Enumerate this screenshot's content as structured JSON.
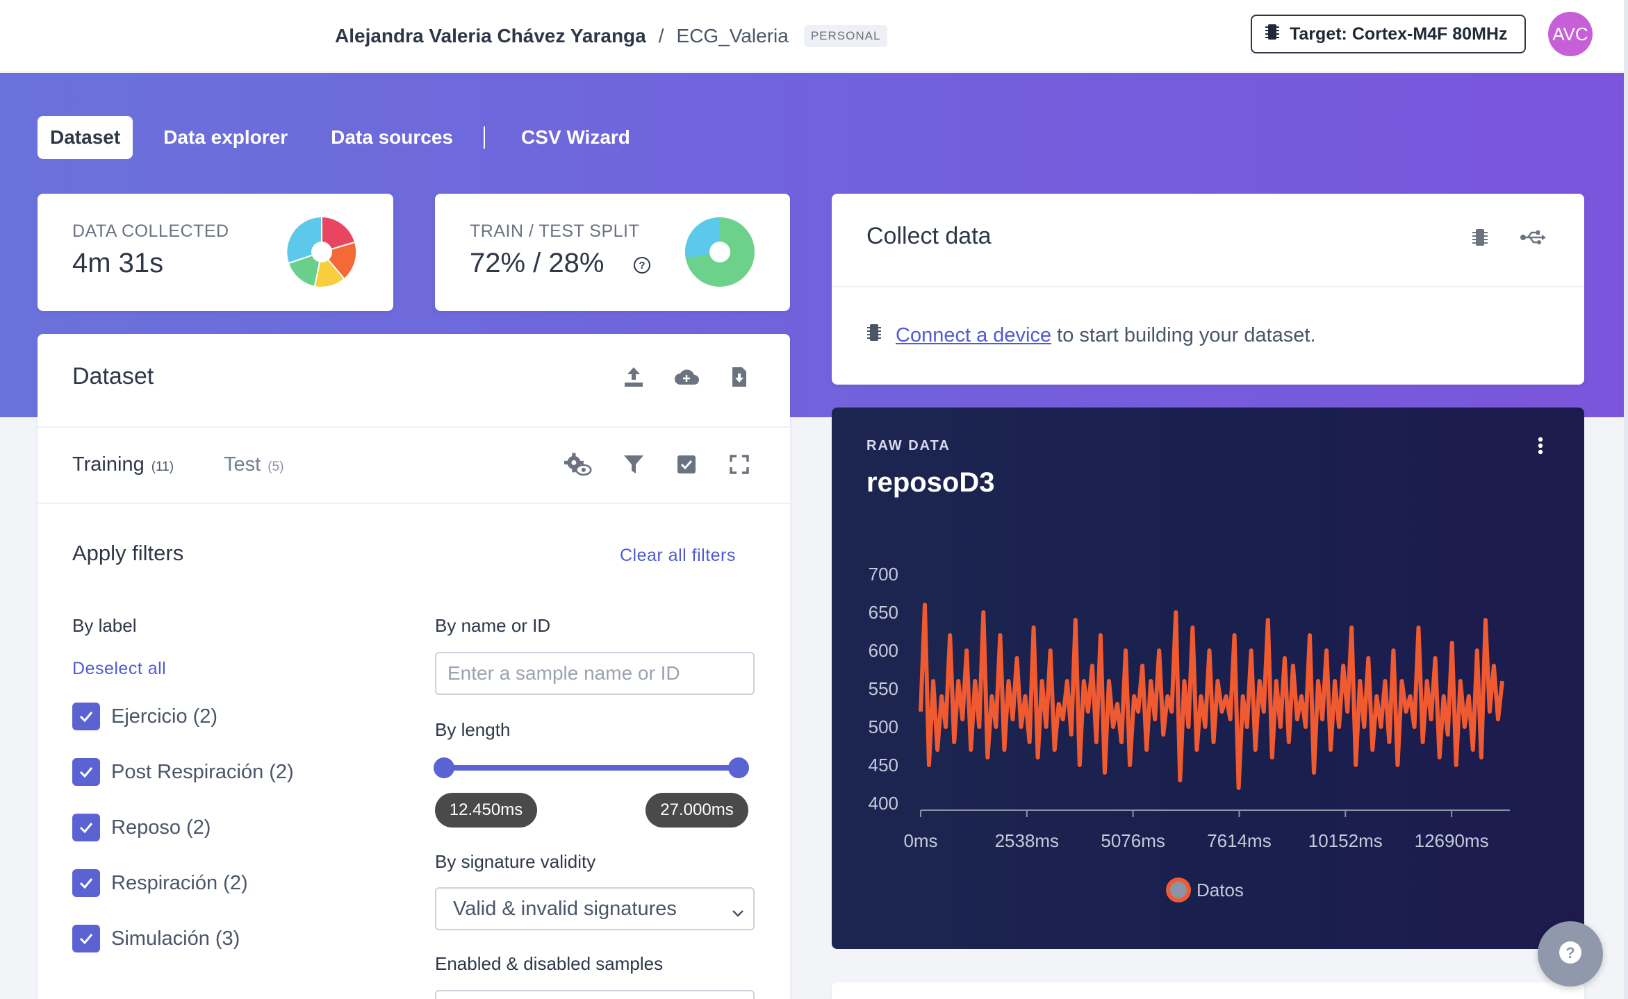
{
  "header": {
    "owner": "Alejandra Valeria Chávez Yaranga",
    "separator": "/",
    "project": "ECG_Valeria",
    "badge": "PERSONAL",
    "target_label": "Target: Cortex-M4F 80MHz",
    "avatar_initials": "AVC"
  },
  "tabs": [
    {
      "label": "Dataset",
      "active": true
    },
    {
      "label": "Data explorer",
      "active": false
    },
    {
      "label": "Data sources",
      "active": false
    },
    {
      "label": "CSV Wizard",
      "active": false
    }
  ],
  "stats": {
    "data_collected": {
      "label": "DATA COLLECTED",
      "value": "4m 31s"
    },
    "split": {
      "label": "TRAIN / TEST SPLIT",
      "value": "72% / 28%",
      "train_fraction": 0.72
    }
  },
  "collect": {
    "title": "Collect data",
    "link_text": "Connect a device",
    "rest_text": " to start building your dataset."
  },
  "dataset": {
    "title": "Dataset",
    "training_label": "Training",
    "training_count": "(11)",
    "test_label": "Test",
    "test_count": "(5)"
  },
  "filters": {
    "title": "Apply filters",
    "clear_all": "Clear all filters",
    "by_label": "By label",
    "deselect_all": "Deselect all",
    "labels": [
      {
        "text": "Ejercicio (2)",
        "checked": true
      },
      {
        "text": "Post Respiración (2)",
        "checked": true
      },
      {
        "text": "Reposo (2)",
        "checked": true
      },
      {
        "text": "Respiración (2)",
        "checked": true
      },
      {
        "text": "Simulación (3)",
        "checked": true
      }
    ],
    "by_name": "By name or ID",
    "name_placeholder": "Enter a sample name or ID",
    "by_length": "By length",
    "length_min": "12.450ms",
    "length_max": "27.000ms",
    "by_signature": "By signature validity",
    "signature_value": "Valid & invalid signatures",
    "enabled_label": "Enabled & disabled samples"
  },
  "raw": {
    "label": "RAW DATA",
    "title": "reposoD3"
  },
  "colors": {
    "accent": "#5b63d3",
    "series": "#f05a30",
    "chart_bg": "#1c2150"
  },
  "chart_data": {
    "type": "line",
    "legend_position": "bottom-center",
    "x_ticks": [
      "0ms",
      "2538ms",
      "5076ms",
      "7614ms",
      "10152ms",
      "12690ms"
    ],
    "ylim": [
      400,
      700
    ],
    "y_ticks": [
      "700",
      "650",
      "600",
      "550",
      "500",
      "450",
      "400"
    ],
    "xlim": [
      0,
      14000
    ],
    "series": [
      {
        "name": "Datos",
        "color": "#f05a30",
        "x": [
          0,
          100,
          200,
          300,
          400,
          500,
          600,
          700,
          800,
          900,
          1000,
          1100,
          1200,
          1300,
          1400,
          1500,
          1600,
          1700,
          1800,
          1900,
          2000,
          2100,
          2200,
          2300,
          2400,
          2500,
          2600,
          2700,
          2800,
          2900,
          3000,
          3100,
          3200,
          3300,
          3400,
          3500,
          3600,
          3700,
          3800,
          3900,
          4000,
          4100,
          4200,
          4300,
          4400,
          4500,
          4600,
          4700,
          4800,
          4900,
          5000,
          5100,
          5200,
          5300,
          5400,
          5500,
          5600,
          5700,
          5800,
          5900,
          6000,
          6100,
          6200,
          6300,
          6400,
          6500,
          6600,
          6700,
          6800,
          6900,
          7000,
          7100,
          7200,
          7300,
          7400,
          7500,
          7600,
          7700,
          7800,
          7900,
          8000,
          8100,
          8200,
          8300,
          8400,
          8500,
          8600,
          8700,
          8800,
          8900,
          9000,
          9100,
          9200,
          9300,
          9400,
          9500,
          9600,
          9700,
          9800,
          9900,
          10000,
          10100,
          10200,
          10300,
          10400,
          10500,
          10600,
          10700,
          10800,
          10900,
          11000,
          11100,
          11200,
          11300,
          11400,
          11500,
          11600,
          11700,
          11800,
          11900,
          12000,
          12100,
          12200,
          12300,
          12400,
          12500,
          12600,
          12700,
          12800,
          12900,
          13000,
          13100,
          13200,
          13300,
          13400,
          13500,
          13600,
          13700,
          13800,
          13900
        ],
        "values": [
          520,
          660,
          450,
          560,
          470,
          540,
          500,
          620,
          480,
          560,
          510,
          600,
          470,
          560,
          500,
          650,
          460,
          540,
          500,
          620,
          470,
          560,
          510,
          590,
          500,
          540,
          480,
          630,
          460,
          560,
          500,
          600,
          470,
          530,
          510,
          560,
          490,
          640,
          450,
          560,
          520,
          580,
          480,
          620,
          440,
          560,
          500,
          530,
          480,
          600,
          450,
          540,
          520,
          580,
          470,
          560,
          510,
          600,
          490,
          540,
          520,
          650,
          430,
          560,
          500,
          630,
          470,
          540,
          500,
          600,
          480,
          560,
          520,
          540,
          510,
          620,
          420,
          540,
          500,
          600,
          470,
          560,
          520,
          640,
          460,
          560,
          500,
          590,
          480,
          580,
          510,
          540,
          500,
          620,
          440,
          560,
          510,
          600,
          470,
          560,
          500,
          580,
          520,
          630,
          450,
          560,
          500,
          590,
          470,
          540,
          500,
          560,
          480,
          600,
          450,
          560,
          520,
          540,
          500,
          630,
          480,
          560,
          510,
          590,
          460,
          540,
          490,
          610,
          450,
          560,
          500,
          540,
          470,
          600,
          460,
          640,
          520,
          580,
          510,
          560
        ]
      }
    ]
  }
}
